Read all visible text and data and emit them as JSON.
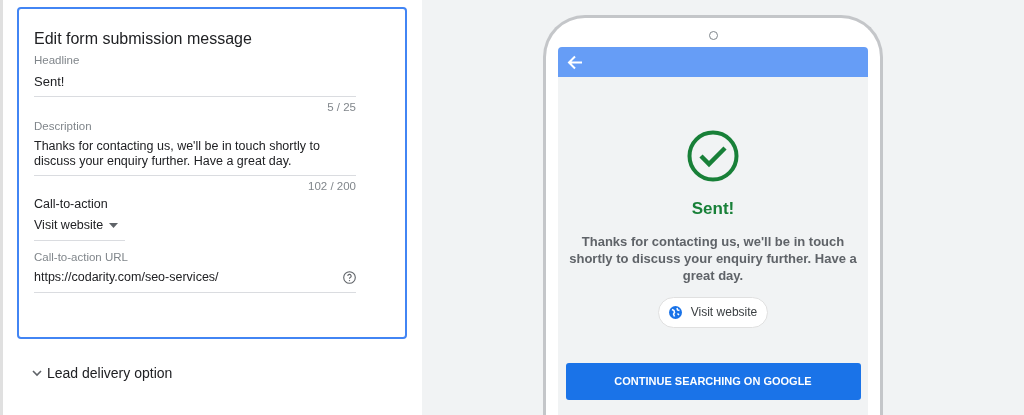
{
  "form": {
    "title": "Edit form submission message",
    "headline": {
      "label": "Headline",
      "value": "Sent!",
      "counter": "5 / 25"
    },
    "description": {
      "label": "Description",
      "value": "Thanks for contacting us, we'll be in touch shortly to discuss your enquiry further. Have a great day.",
      "counter": "102 / 200"
    },
    "cta": {
      "label": "Call-to-action",
      "value": "Visit website"
    },
    "cta_url": {
      "label": "Call-to-action URL",
      "value": "https://codarity.com/seo-services/"
    }
  },
  "lead_delivery": {
    "label": "Lead delivery option",
    "expanded": false
  },
  "preview": {
    "headline": "Sent!",
    "description": "Thanks for contacting us, we'll be in touch shortly to discuss your enquiry further. Have a great day.",
    "cta_button": "Visit website",
    "continue_button": "CONTINUE SEARCHING ON GOOGLE"
  }
}
